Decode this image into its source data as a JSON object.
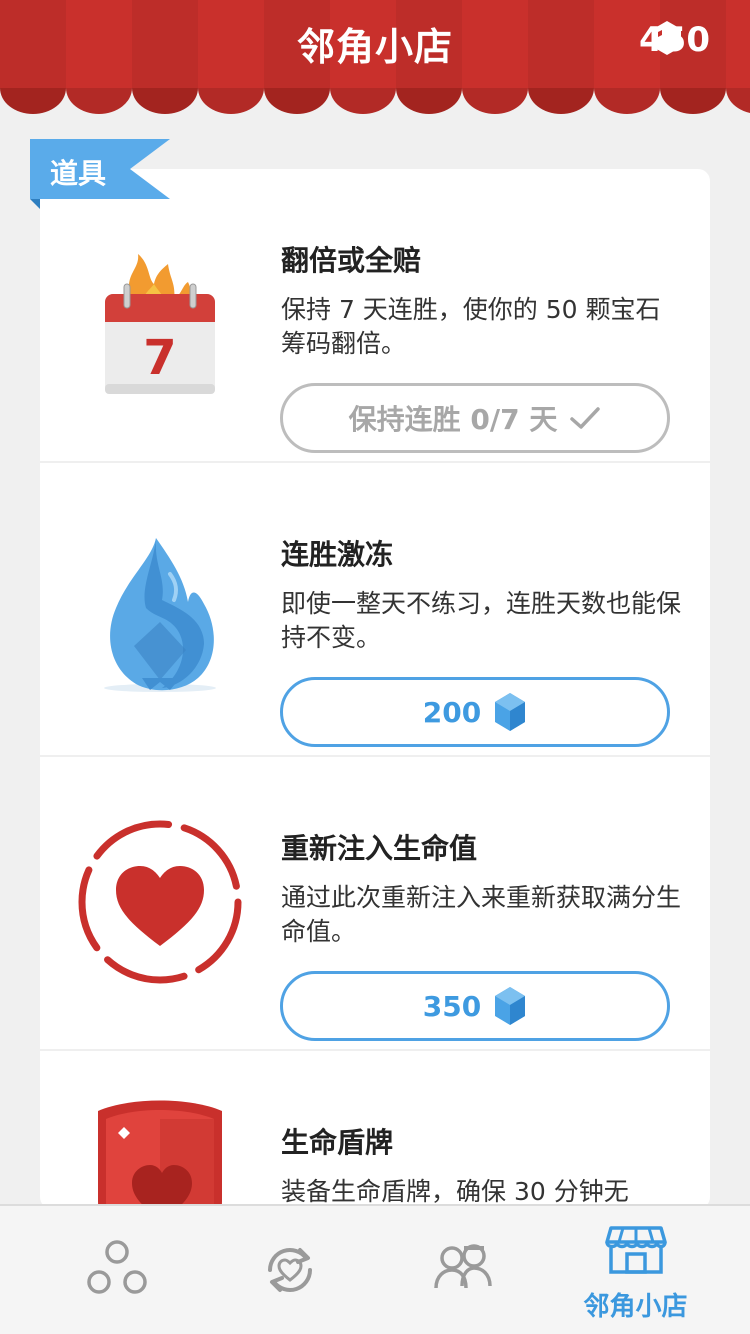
{
  "header": {
    "title": "邻角小店",
    "gem_count": "450",
    "gem_icon": "gem-icon",
    "awning_colors": [
      "#c9302c",
      "#b22a26"
    ]
  },
  "section": {
    "ribbon_label": "道具",
    "ribbon_color": "#5aabea"
  },
  "items": [
    {
      "name": "翻倍或全赔",
      "description": "保持 7 天连胜，使你的 50 颗宝石筹码翻倍。",
      "icon": "calendar-flame-icon",
      "calendar_day": "7",
      "button_label": "保持连胜 0/7 天",
      "button_icon": "checkmark-icon",
      "button_state": "disabled"
    },
    {
      "name": "连胜激冻",
      "description": "即使一整天不练习，连胜天数也能保持不变。",
      "icon": "frozen-flame-icon",
      "button_label": "200",
      "button_icon": "gem-icon",
      "button_state": "buy"
    },
    {
      "name": "重新注入生命值",
      "description": "通过此次重新注入来重新获取满分生命值。",
      "icon": "heart-refill-icon",
      "button_label": "350",
      "button_icon": "gem-icon",
      "button_state": "buy"
    },
    {
      "name": "生命盾牌",
      "description": "装备生命盾牌，确保 30 分钟无",
      "icon": "heart-shield-icon"
    }
  ],
  "nav": {
    "items": [
      {
        "name": "learn",
        "icon": "circles-icon"
      },
      {
        "name": "practice",
        "icon": "heart-refresh-icon"
      },
      {
        "name": "friends",
        "icon": "people-icon"
      },
      {
        "name": "shop",
        "icon": "shop-icon",
        "label": "邻角小店",
        "active": true
      }
    ],
    "active_color": "#3b98de"
  }
}
